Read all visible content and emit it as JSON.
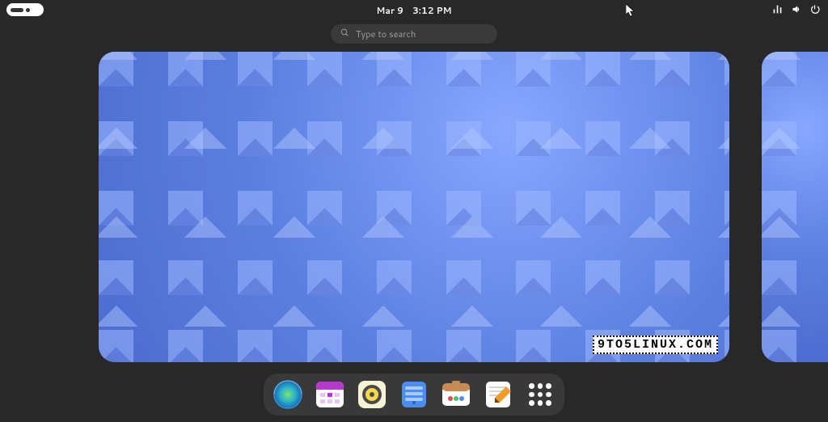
{
  "topbar": {
    "date": "Mar 9",
    "time": "3:12 PM"
  },
  "status_icons": [
    "network-icon",
    "volume-icon",
    "power-icon"
  ],
  "search": {
    "placeholder": "Type to search"
  },
  "dock": [
    {
      "name": "web-browser",
      "label": "Web"
    },
    {
      "name": "calendar",
      "label": "Calendar"
    },
    {
      "name": "music-player",
      "label": "Rhythmbox"
    },
    {
      "name": "files",
      "label": "Files"
    },
    {
      "name": "software",
      "label": "Software"
    },
    {
      "name": "text-editor",
      "label": "Text Editor"
    },
    {
      "name": "app-grid",
      "label": "Show Apps"
    }
  ],
  "watermark": "9TO5LINUX.COM"
}
